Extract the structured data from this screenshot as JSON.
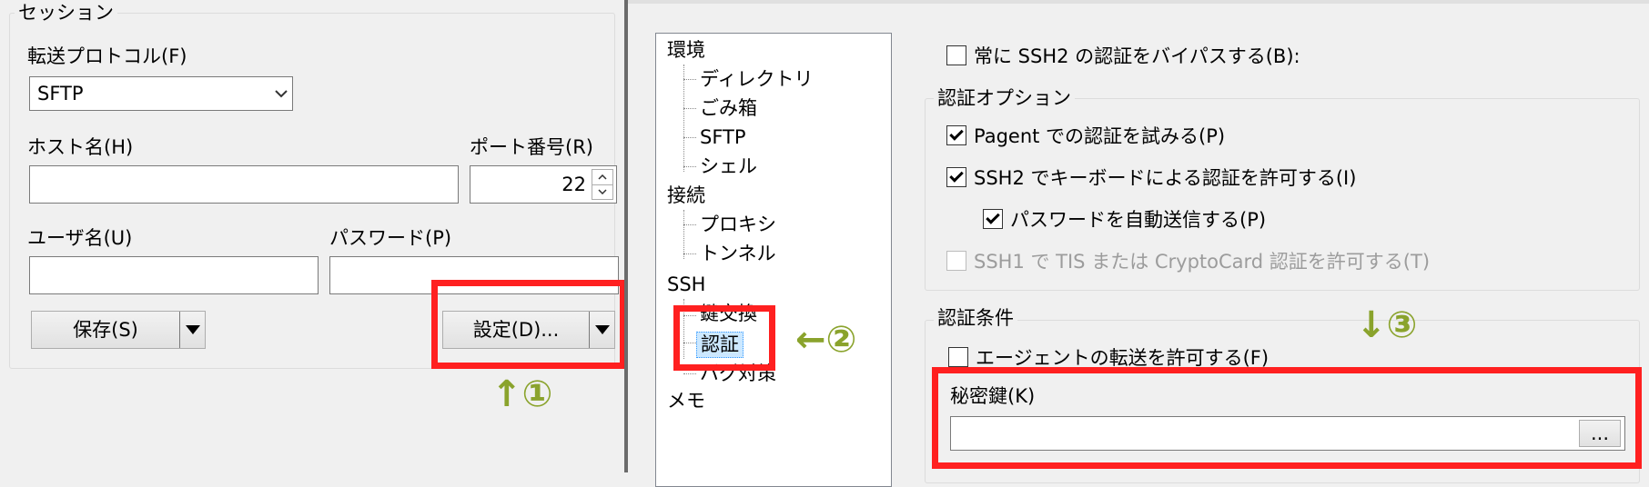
{
  "session": {
    "group_title": "セッション",
    "protocol_label": "転送プロトコル(F)",
    "protocol_value": "SFTP",
    "host_label": "ホスト名(H)",
    "host_value": "",
    "port_label": "ポート番号(R)",
    "port_value": "22",
    "user_label": "ユーザ名(U)",
    "user_value": "",
    "password_label": "パスワード(P)",
    "password_value": "",
    "save_button": "保存(S)",
    "settings_button": "設定(D)..."
  },
  "tree": {
    "root_env": "環境",
    "env_children": [
      "ディレクトリ",
      "ごみ箱",
      "SFTP",
      "シェル"
    ],
    "root_connection": "接続",
    "connection_children": [
      "プロキシ",
      "トンネル"
    ],
    "root_ssh": "SSH",
    "ssh_children": [
      "鍵交換",
      "認証",
      "バグ対策"
    ],
    "root_memo": "メモ"
  },
  "auth": {
    "bypass_label": "常に SSH2 の認証をバイパスする(B):",
    "bypass_checked": false,
    "options_group_title": "認証オプション",
    "pageant_label": "Pagent での認証を試みる(P)",
    "pageant_checked": true,
    "keyboard_label": "SSH2 でキーボードによる認証を許可する(I)",
    "keyboard_checked": true,
    "autopass_label": "パスワードを自動送信する(P)",
    "autopass_checked": true,
    "tis_label": "SSH1 で TIS または CryptoCard 認証を許可する(T)",
    "tis_checked": false,
    "conditions_group_title": "認証条件",
    "agent_forward_label": "エージェントの転送を許可する(F)",
    "agent_forward_checked": false,
    "private_key_label": "秘密鍵(K)",
    "private_key_value": "",
    "browse_button": "..."
  },
  "annotations": {
    "step1": "↑①",
    "step2": "←②",
    "step3": "↓③"
  },
  "colors": {
    "highlight": "#ff2020",
    "annotation": "#8aa32c"
  }
}
